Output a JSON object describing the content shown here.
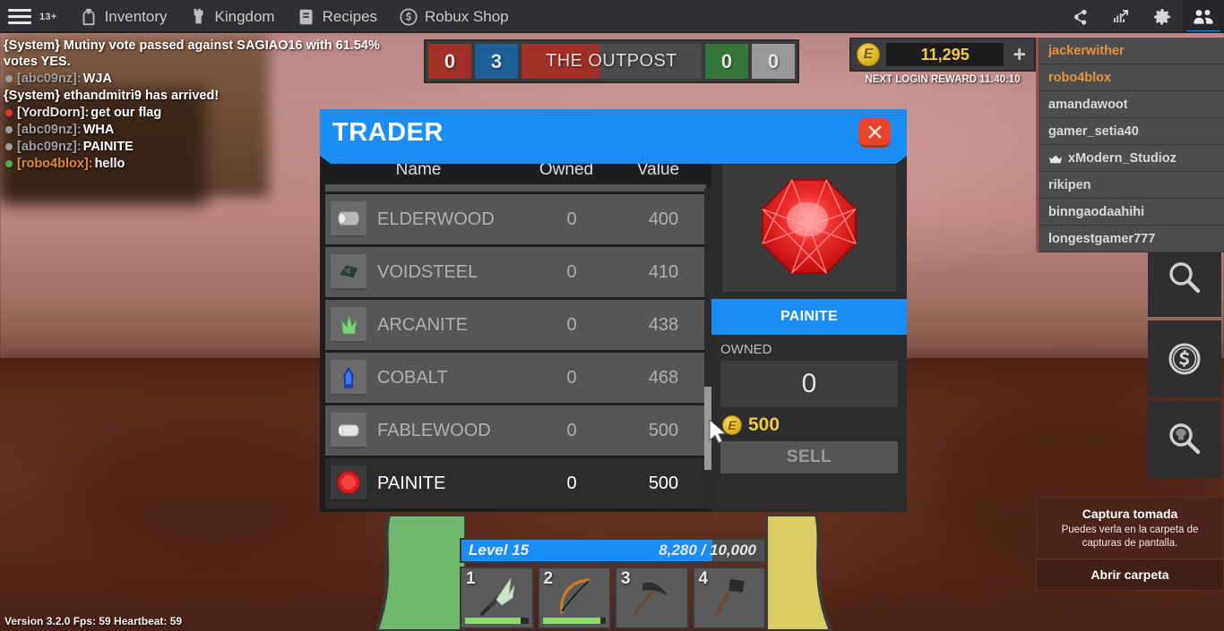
{
  "topbar": {
    "menu_icon": "hamburger-icon",
    "age_badge": "13+",
    "items": [
      {
        "label": "Inventory",
        "icon": "backpack-icon"
      },
      {
        "label": "Kingdom",
        "icon": "castle-tower-icon"
      },
      {
        "label": "Recipes",
        "icon": "scroll-icon"
      },
      {
        "label": "Robux Shop",
        "icon": "robux-coin-icon"
      }
    ],
    "right_icons": [
      {
        "name": "share-icon",
        "active": false
      },
      {
        "name": "chart-icon",
        "active": false
      },
      {
        "name": "gear-icon",
        "active": false
      },
      {
        "name": "players-icon",
        "active": true
      }
    ]
  },
  "chat": {
    "lines": [
      {
        "type": "system",
        "text": "{System} Mutiny vote passed against SAGIAO16 with 61.54% votes YES.",
        "color": "#ffffff",
        "bullet": null
      },
      {
        "type": "player",
        "name": "[abc09nz]:",
        "text": "WJA",
        "name_color": "#9e9e9e",
        "text_color": "#ffffff",
        "bullet": "#9e9e9e"
      },
      {
        "type": "system",
        "text": "{System} ethandmitri9 has arrived!",
        "color": "#ffffff",
        "bullet": null
      },
      {
        "type": "player",
        "name": "[YordDorn]:",
        "text": "get our flag",
        "name_color": "#e8e8e8",
        "text_color": "#ffffff",
        "bullet": "#d83a2a"
      },
      {
        "type": "player",
        "name": "[abc09nz]:",
        "text": "WHA",
        "name_color": "#9e9e9e",
        "text_color": "#ffffff",
        "bullet": "#9e9e9e"
      },
      {
        "type": "player",
        "name": "[abc09nz]:",
        "text": "PAINITE",
        "name_color": "#9e9e9e",
        "text_color": "#ffffff",
        "bullet": "#9e9e9e"
      },
      {
        "type": "player",
        "name": "[robo4blox]:",
        "text": "hello",
        "name_color": "#e0892f",
        "text_color": "#ffffff",
        "bullet": "#4caf50"
      }
    ]
  },
  "scoreboard": {
    "left_score": "0",
    "blue_score": "3",
    "title_prefix": "THE ",
    "title_suffix": "OUTPOST",
    "title_full": "THE OUTPOST",
    "capture_percent": 44,
    "green_score": "0",
    "grey_score": "0"
  },
  "currency": {
    "icon": "e-coin-icon",
    "amount": "11,295",
    "plus_label": "+",
    "next_reward": "NEXT LOGIN REWARD 11:40:10"
  },
  "players": [
    {
      "name": "jackerwither",
      "highlight": true,
      "crown": false
    },
    {
      "name": "robo4blox",
      "highlight": true,
      "crown": false
    },
    {
      "name": "amandawoot",
      "highlight": false,
      "crown": false
    },
    {
      "name": "gamer_setia40",
      "highlight": false,
      "crown": false
    },
    {
      "name": "xModern_Studioz",
      "highlight": false,
      "crown": true
    },
    {
      "name": "rikipen",
      "highlight": false,
      "crown": false
    },
    {
      "name": "binngaodaahihi",
      "highlight": false,
      "crown": false
    },
    {
      "name": "longestgamer777",
      "highlight": false,
      "crown": false
    }
  ],
  "side_buttons": [
    {
      "name": "magnifier-icon"
    },
    {
      "name": "dollar-coin-icon"
    },
    {
      "name": "tree-magnifier-icon"
    }
  ],
  "trader": {
    "title": "TRADER",
    "close_icon": "close-icon",
    "columns": {
      "name": "Name",
      "owned": "Owned",
      "value": "Value"
    },
    "items": [
      {
        "name": "ELDERWOOD",
        "owned": "0",
        "value": "400",
        "icon": "log-icon",
        "selected": false
      },
      {
        "name": "VOIDSTEEL",
        "owned": "0",
        "value": "410",
        "icon": "ore-dark-icon",
        "selected": false
      },
      {
        "name": "ARCANITE",
        "owned": "0",
        "value": "438",
        "icon": "crystal-green-icon",
        "selected": false
      },
      {
        "name": "COBALT",
        "owned": "0",
        "value": "468",
        "icon": "crystal-blue-icon",
        "selected": false
      },
      {
        "name": "FABLEWOOD",
        "owned": "0",
        "value": "500",
        "icon": "log-white-icon",
        "selected": false
      },
      {
        "name": "PAINITE",
        "owned": "0",
        "value": "500",
        "icon": "gem-red-icon",
        "selected": true
      }
    ],
    "detail": {
      "preview_icon": "gem-red-icon",
      "name": "PAINITE",
      "owned_label": "OWNED",
      "owned_value": "0",
      "price": "500",
      "price_icon": "e-coin-icon",
      "sell_label": "SELL"
    }
  },
  "hud": {
    "level_label": "Level 15",
    "xp_text": "8,280 / 10,000",
    "xp_percent": 82.8,
    "slots": [
      {
        "number": "1",
        "icon": "spear-icon",
        "durability": 88
      },
      {
        "number": "2",
        "icon": "bow-icon",
        "durability": 92
      },
      {
        "number": "3",
        "icon": "pickaxe-icon",
        "durability": null
      },
      {
        "number": "4",
        "icon": "axe-icon",
        "durability": null
      }
    ]
  },
  "version_line": "Version 3.2.0   Fps: 59   Heartbeat: 59",
  "toast": {
    "title": "Captura tomada",
    "message": "Puedes verla en la carpeta de capturas de pantalla.",
    "button": "Abrir carpeta"
  }
}
